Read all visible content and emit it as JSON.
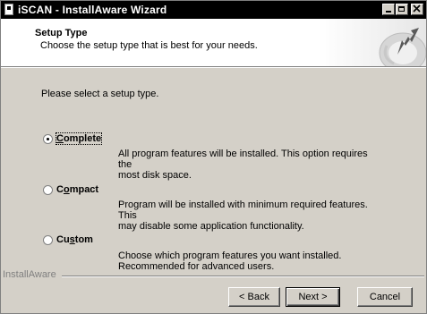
{
  "window": {
    "title": "iSCAN - InstallAware Wizard"
  },
  "header": {
    "title": "Setup Type",
    "subtitle": "Choose the setup type that is best for your needs."
  },
  "content": {
    "prompt": "Please select a setup type.",
    "options": [
      {
        "pre": "",
        "mnemonic": "C",
        "post": "omplete",
        "selected": true,
        "description": [
          "All program features will be installed. This option requires the",
          "most disk space."
        ]
      },
      {
        "pre": "C",
        "mnemonic": "o",
        "post": "mpact",
        "selected": false,
        "description": [
          "Program will be installed with minimum required features. This",
          "may disable some application functionality."
        ]
      },
      {
        "pre": "Cu",
        "mnemonic": "s",
        "post": "tom",
        "selected": false,
        "description": [
          "Choose which program features you want installed.",
          "Recommended for advanced users."
        ]
      }
    ]
  },
  "footer": {
    "brand": "InstallAware",
    "back_label": "< Back",
    "next_label": "Next >",
    "cancel_label": "Cancel"
  },
  "icons": {
    "window": "installer-icon",
    "header_graphic": "green-arrow-disc-icon"
  }
}
